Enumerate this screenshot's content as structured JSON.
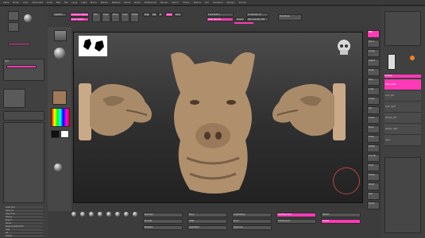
{
  "menu": {
    "items": [
      "Alpha",
      "Brush",
      "Color",
      "Document",
      "Draw",
      "Edit",
      "File",
      "Layer",
      "Light",
      "Macro",
      "Marker",
      "Material",
      "Movie",
      "Picker",
      "Preferences",
      "Render",
      "Stencil",
      "Stroke",
      "Texture",
      "Tool",
      "Transform",
      "Zplugin",
      "Zscript"
    ]
  },
  "topshelf": {
    "buttons": [
      "LightBox",
      "Projection Master",
      "Quick Sketch",
      "Edit",
      "Draw",
      "Move",
      "Scale",
      "Rotate",
      "Mrgb",
      "Rgb",
      "M",
      "Zadd",
      "Zsub",
      "Focal Shift 0",
      "Draw Size 64",
      "Dynamic",
      "Z Intensity 25",
      "Rgb Intensity 100"
    ],
    "quicksave": "QuickSave"
  },
  "leftpanel": {
    "header": "Tool",
    "list": [
      "Load Tool",
      "Save As",
      "Copy Tool",
      "Import",
      "Export",
      "Clone",
      "Make PolyMesh3D",
      "GoZ",
      "All",
      "Visible",
      "R"
    ]
  },
  "bottombar": {
    "buttons": [
      "Standard",
      "Move",
      "ClayBuildup",
      "DamStandard",
      "hPolish",
      "Smooth",
      "Inflat",
      "Pinch",
      "TrimDynamic",
      "Slash3",
      "MaskPen",
      "SelectRect",
      "ClipCurve"
    ]
  },
  "rightpanel": {
    "buttons": [
      "BPR",
      "SPix 3",
      "Actual",
      "AAHalf",
      "Persp",
      "Floor",
      "Local",
      "L.Sym",
      "Xyz",
      "Frame",
      "Move",
      "Scale",
      "Rotate",
      "Line Fill",
      "PolyF",
      "Transp",
      "Ghost",
      "Solo",
      "Xpose"
    ],
    "subtool_header": "SubTool",
    "subtools": [
      "boar_head",
      "boar_left",
      "boar_right",
      "plaque_left",
      "plaque_right",
      "eyes"
    ]
  },
  "colors": {
    "accent": "#ff3ab6",
    "sculpt": "#b59a7a"
  }
}
